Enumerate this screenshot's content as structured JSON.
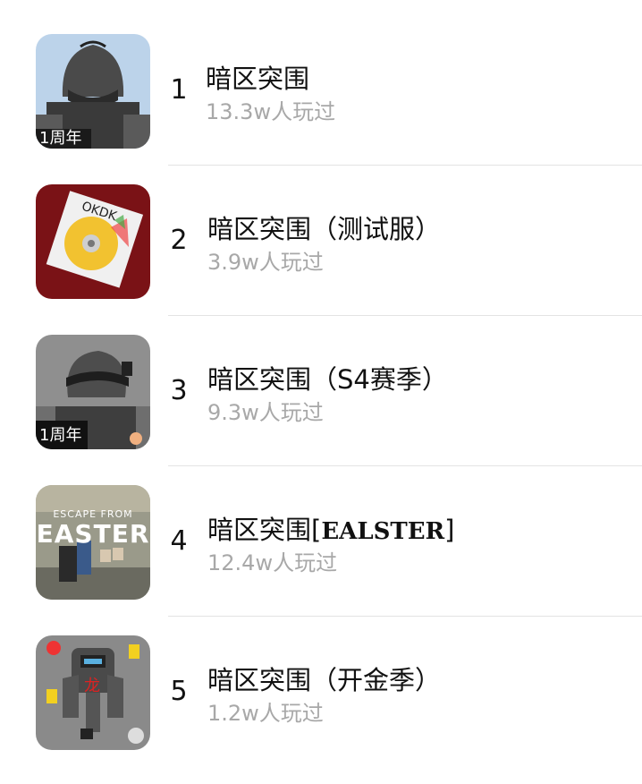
{
  "games": [
    {
      "rank": "1",
      "title": "暗区突围",
      "plays": "13.3w人玩过",
      "badge": "1周年"
    },
    {
      "rank": "2",
      "title": "暗区突围（测试服）",
      "plays": "3.9w人玩过",
      "badge": ""
    },
    {
      "rank": "3",
      "title": "暗区突围（S4赛季）",
      "plays": "9.3w人玩过",
      "badge": "1周年"
    },
    {
      "rank": "4",
      "title": "暗区突围[",
      "title_styled": "EALSTER",
      "title_end": "]",
      "plays": "12.4w人玩过",
      "art_text_top": "ESCAPE FROM",
      "art_text_main": "EASTER"
    },
    {
      "rank": "5",
      "title": "暗区突围（开金季）",
      "plays": "1.2w人玩过",
      "badge": ""
    }
  ]
}
